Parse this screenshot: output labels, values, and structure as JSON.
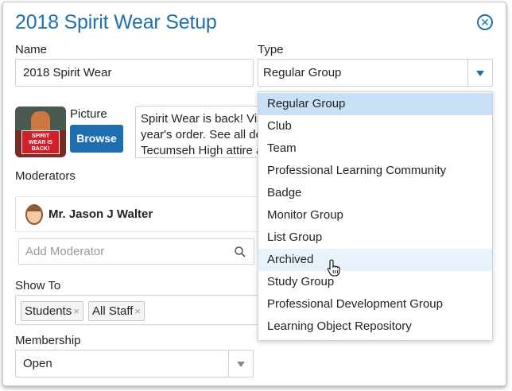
{
  "dialog": {
    "title": "2018 Spirit Wear Setup",
    "close_icon": "close-circle-icon",
    "close_glyph": "✕"
  },
  "name": {
    "label": "Name",
    "value": "2018 Spirit Wear"
  },
  "type": {
    "label": "Type",
    "value": "Regular Group",
    "options": [
      "Regular Group",
      "Club",
      "Team",
      "Professional Learning Community",
      "Badge",
      "Monitor Group",
      "List Group",
      "Archived",
      "Study Group",
      "Professional Development Group",
      "Learning Object Repository"
    ],
    "selected_index": 0,
    "hovered_index": 7
  },
  "picture": {
    "label": "Picture",
    "browse_label": "Browse",
    "badge_line1": "SPIRIT",
    "badge_line2": "WEAR IS",
    "badge_line3": "BACK!"
  },
  "description": {
    "line1": "Spirit Wear is back! Vis",
    "line2": "year's order. See all des",
    "line3": "Tecumseh High attire a"
  },
  "moderators": {
    "label": "Moderators",
    "items": [
      {
        "name": "Mr. Jason J Walter"
      }
    ],
    "add_placeholder": "Add Moderator"
  },
  "show_to": {
    "label": "Show To",
    "tags": [
      "Students",
      "All Staff"
    ],
    "remove_glyph": "×"
  },
  "membership": {
    "label": "Membership",
    "value": "Open"
  },
  "colors": {
    "accent": "#1f6fb0",
    "selected_option": "#c7e0f5",
    "hover_option": "#e9f2fa"
  }
}
